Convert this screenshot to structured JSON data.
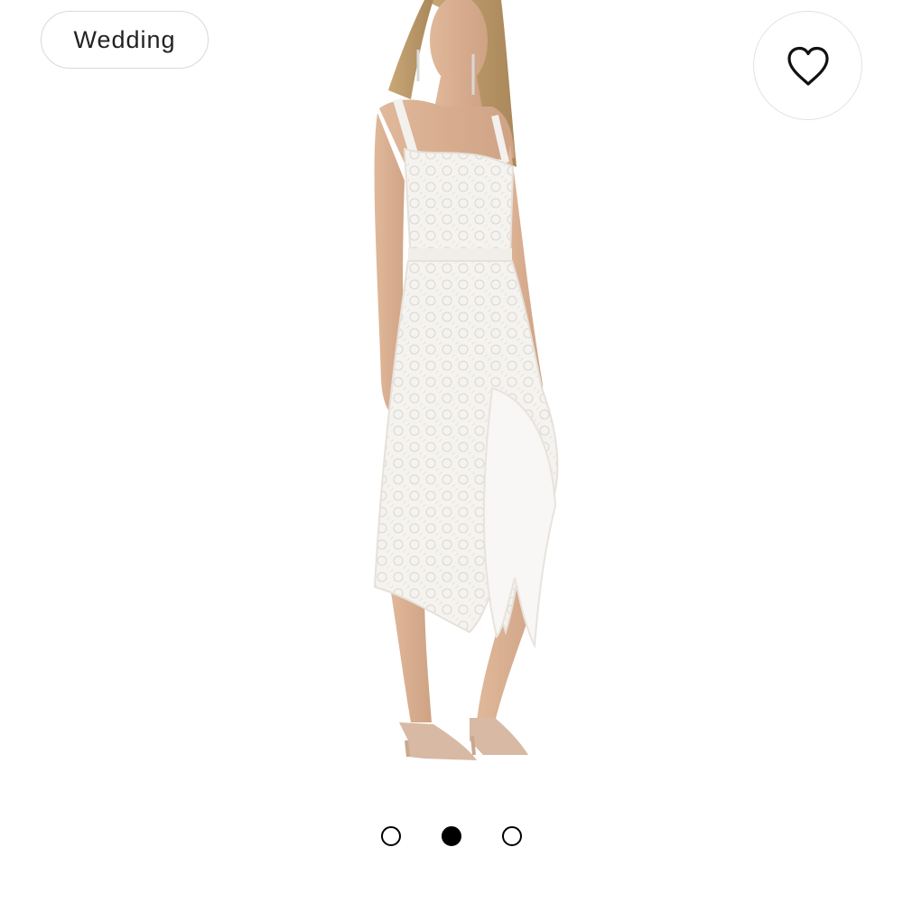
{
  "category_chip": {
    "label": "Wedding"
  },
  "favorite": {
    "icon": "heart-icon",
    "state": "not-favorited"
  },
  "product_image": {
    "icon": "dress-photo"
  },
  "carousel": {
    "total": 3,
    "active_index": 2
  },
  "colors": {
    "background": "#ffffff",
    "chip_border": "#d9d9d9",
    "dot_active": "#000000"
  }
}
